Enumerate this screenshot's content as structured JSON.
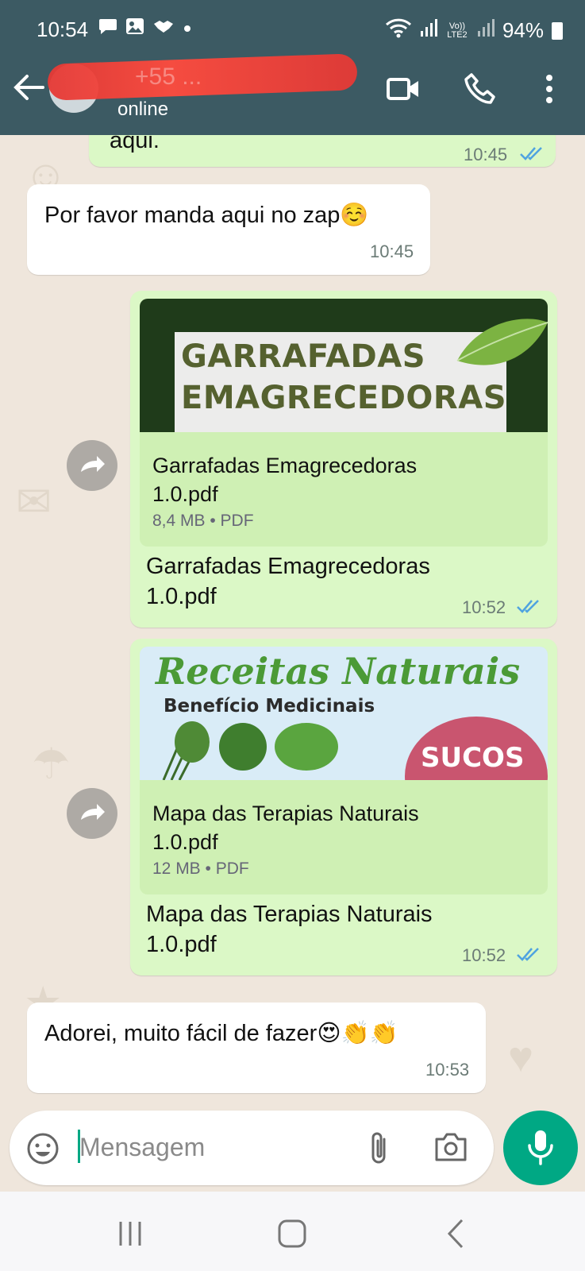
{
  "status_bar": {
    "time": "10:54",
    "left_icons": [
      "chat-icon",
      "image-icon",
      "handshake-icon",
      "dot-icon"
    ],
    "right_icons": [
      "wifi-icon",
      "signal-icon",
      "volte-icon",
      "signal-icon"
    ],
    "volte_label": "Vo)) LTE2",
    "battery": "94%"
  },
  "header": {
    "contact_name": "+55 ...",
    "contact_status": "online",
    "icons": [
      "back-arrow-icon",
      "video-call-icon",
      "phone-icon",
      "more-vert-icon"
    ]
  },
  "messages": [
    {
      "type": "text",
      "direction": "out",
      "text": "aqui.",
      "time": "10:45",
      "ticks": "read"
    },
    {
      "type": "text",
      "direction": "in",
      "text": "Por favor manda aqui no zap☺️",
      "time": "10:45"
    },
    {
      "type": "document",
      "direction": "out",
      "forwarded_button": "forward-icon",
      "thumbnail_lines": [
        "GARRAFADAS",
        "EMAGRECEDORAS"
      ],
      "file_name": "Garrafadas Emagrecedoras 1.0.pdf",
      "file_meta": "8,4 MB • PDF",
      "caption": "Garrafadas Emagrecedoras 1.0.pdf",
      "time": "10:52",
      "ticks": "read"
    },
    {
      "type": "document",
      "direction": "out",
      "forwarded_button": "forward-icon",
      "thumbnail_title": "Receitas Naturais",
      "thumbnail_subtitle": "Benefício Medicinais",
      "thumbnail_badge": "SUCOS",
      "file_name": "Mapa das Terapias Naturais 1.0.pdf",
      "file_meta": "12 MB • PDF",
      "caption": "Mapa das Terapias Naturais 1.0.pdf",
      "time": "10:52",
      "ticks": "read"
    },
    {
      "type": "text",
      "direction": "in",
      "text": "Adorei, muito fácil de fazer😍👏👏",
      "time": "10:53"
    }
  ],
  "composer": {
    "placeholder": "Mensagem",
    "icons": [
      "emoji-icon",
      "attach-icon",
      "camera-icon",
      "mic-icon"
    ]
  },
  "nav_bar": {
    "icons": [
      "recent-apps-icon",
      "home-icon",
      "back-icon"
    ]
  },
  "colors": {
    "header": "#3c5a63",
    "outgoing_bubble": "#dbf8c6",
    "incoming_bubble": "#ffffff",
    "accent": "#00a884",
    "read_ticks": "#4fa3e0"
  }
}
